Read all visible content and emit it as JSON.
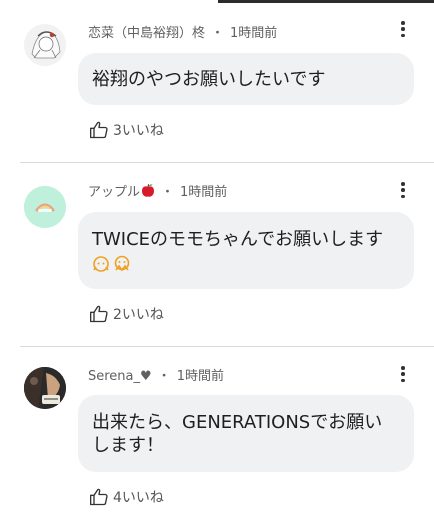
{
  "comments": [
    {
      "author": "恋菜（中島裕翔）柊",
      "time": "1時間前",
      "text": "裕翔のやつお願いしたいです",
      "likes": "3いいね"
    },
    {
      "author": "アップル",
      "time": "1時間前",
      "text": "TWICEのモモちゃんでお願いします",
      "likes": "2いいね"
    },
    {
      "author": "Serena_♥",
      "time": "1時間前",
      "text": "出来たら、GENERATIONSでお願いします！",
      "likes": "4いいね"
    }
  ],
  "separator": "・",
  "icons": [
    "more-vert-icon",
    "thumbs-up-icon",
    "apple-emoji",
    "face-emoji"
  ],
  "colors": {
    "bubble": "#f0f1f3",
    "meta_text": "#606060",
    "apple": "#d81b2a"
  }
}
